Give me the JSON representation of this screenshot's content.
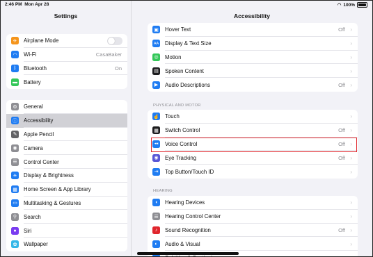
{
  "status": {
    "time": "2:46 PM",
    "date": "Mon Apr 28",
    "battery": "100%"
  },
  "sidebar": {
    "title": "Settings",
    "group1": [
      {
        "label": "Airplane Mode",
        "value": "",
        "icon": "airplane-icon",
        "color": "#f5951c",
        "glyph": "✈",
        "toggle": true
      },
      {
        "label": "Wi-Fi",
        "value": "CasaBaker",
        "icon": "wifi-icon",
        "color": "#1f7cf2",
        "glyph": "◠"
      },
      {
        "label": "Bluetooth",
        "value": "On",
        "icon": "bluetooth-icon",
        "color": "#1f7cf2",
        "glyph": "ᛒ"
      },
      {
        "label": "Battery",
        "value": "",
        "icon": "battery-icon",
        "color": "#34c759",
        "glyph": "▬"
      }
    ],
    "group2": [
      {
        "label": "General",
        "icon": "gear-icon",
        "color": "#8e8e93",
        "glyph": "⚙"
      },
      {
        "label": "Accessibility",
        "icon": "accessibility-icon",
        "color": "#1f7cf2",
        "glyph": "ⓘ",
        "active": true
      },
      {
        "label": "Apple Pencil",
        "icon": "pencil-icon",
        "color": "#636366",
        "glyph": "✎"
      },
      {
        "label": "Camera",
        "icon": "camera-icon",
        "color": "#8e8e93",
        "glyph": "◉"
      },
      {
        "label": "Control Center",
        "icon": "control-center-icon",
        "color": "#8e8e93",
        "glyph": "☰"
      },
      {
        "label": "Display & Brightness",
        "icon": "sun-icon",
        "color": "#1f7cf2",
        "glyph": "☀"
      },
      {
        "label": "Home Screen & App Library",
        "icon": "home-screen-icon",
        "color": "#1f7cf2",
        "glyph": "▦"
      },
      {
        "label": "Multitasking & Gestures",
        "icon": "multitasking-icon",
        "color": "#1f7cf2",
        "glyph": "▭"
      },
      {
        "label": "Search",
        "icon": "search-icon",
        "color": "#8e8e93",
        "glyph": "⚲"
      },
      {
        "label": "Siri",
        "icon": "siri-icon",
        "color": "#7a3cf0",
        "glyph": "●"
      },
      {
        "label": "Wallpaper",
        "icon": "wallpaper-icon",
        "color": "#35b7e8",
        "glyph": "✿"
      }
    ]
  },
  "main": {
    "title": "Accessibility",
    "vision_tail": [
      {
        "label": "Hover Text",
        "value": "Off",
        "icon": "hover-text-icon",
        "color": "#1f7cf2",
        "glyph": "▣"
      },
      {
        "label": "Display & Text Size",
        "value": "",
        "icon": "text-size-icon",
        "color": "#1f7cf2",
        "glyph": "AA"
      },
      {
        "label": "Motion",
        "value": "",
        "icon": "motion-icon",
        "color": "#34c759",
        "glyph": "◎"
      },
      {
        "label": "Spoken Content",
        "value": "",
        "icon": "spoken-content-icon",
        "color": "#1c1c1e",
        "glyph": "▤"
      },
      {
        "label": "Audio Descriptions",
        "value": "Off",
        "icon": "audio-descriptions-icon",
        "color": "#1f7cf2",
        "glyph": "▶"
      }
    ],
    "physical_header": "PHYSICAL AND MOTOR",
    "physical": [
      {
        "label": "Touch",
        "value": "",
        "icon": "touch-icon",
        "color": "#1f7cf2",
        "glyph": "☝"
      },
      {
        "label": "Switch Control",
        "value": "Off",
        "icon": "switch-control-icon",
        "color": "#1c1c1e",
        "glyph": "▦"
      },
      {
        "label": "Voice Control",
        "value": "Off",
        "icon": "voice-control-icon",
        "color": "#1f7cf2",
        "glyph": "◂◂"
      },
      {
        "label": "Eye Tracking",
        "value": "Off",
        "icon": "eye-tracking-icon",
        "color": "#5856d6",
        "glyph": "◉"
      },
      {
        "label": "Top Button/Touch ID",
        "value": "",
        "icon": "top-button-icon",
        "color": "#1f7cf2",
        "glyph": "⇥"
      }
    ],
    "hearing_header": "HEARING",
    "hearing": [
      {
        "label": "Hearing Devices",
        "value": "",
        "icon": "ear-icon",
        "color": "#1f7cf2",
        "glyph": "◖"
      },
      {
        "label": "Hearing Control Center",
        "value": "",
        "icon": "hearing-control-icon",
        "color": "#8e8e93",
        "glyph": "☰"
      },
      {
        "label": "Sound Recognition",
        "value": "Off",
        "icon": "sound-recognition-icon",
        "color": "#e0262d",
        "glyph": "♪"
      },
      {
        "label": "Audio & Visual",
        "value": "",
        "icon": "audio-visual-icon",
        "color": "#1f7cf2",
        "glyph": "◐"
      },
      {
        "label": "Subtitles & Captioning",
        "value": "",
        "icon": "subtitles-icon",
        "color": "#1f7cf2",
        "glyph": "▭"
      }
    ]
  }
}
